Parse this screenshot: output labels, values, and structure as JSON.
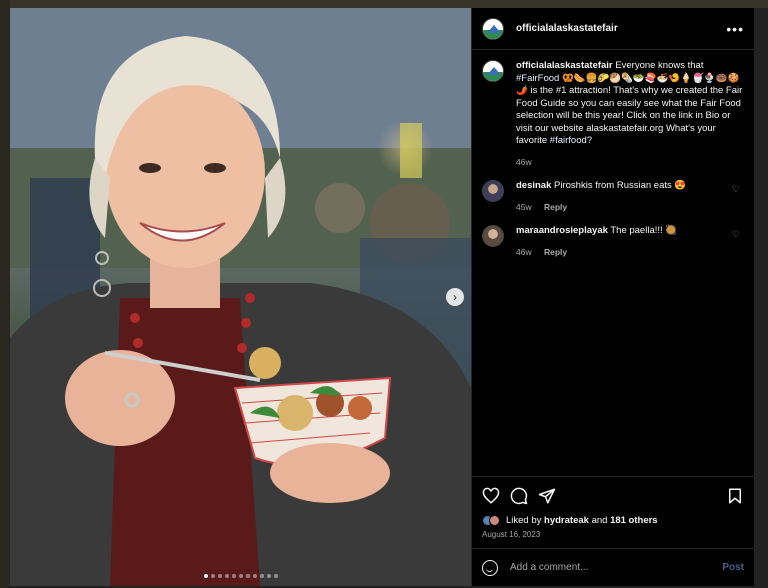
{
  "post": {
    "account": "officialalaskastatefair",
    "more_icon": "ellipsis-icon",
    "caption": {
      "username": "officialalaskastatefair",
      "text_before_tag": "Everyone knows that",
      "hashtag": "#FairFood",
      "emojis": "🥨🌭🍔🌮🥙🌯🥗🍣🍜🍤🍦🍧🍨🍩🍪🌶️",
      "text_after": "is the #1 attraction! That's why we created the Fair Food Guide so you can easily see what the Fair Food selection will be this year! Click on the link in Bio or visit our website alaskastatefair.org What's your favorite",
      "hashtag2": "#fairfood?",
      "age": "46w"
    },
    "comments": [
      {
        "username": "desinak",
        "text": "Piroshkis from Russian eats 😍",
        "age": "45w",
        "reply": "Reply"
      },
      {
        "username": "maraandrosieplayak",
        "text": "The paella!!! 🥘",
        "age": "46w",
        "reply": "Reply"
      }
    ],
    "likes": {
      "prefix": "Liked by",
      "user": "hydrateak",
      "and": "and",
      "others": "181 others"
    },
    "date": "August 16, 2023",
    "add_comment_placeholder": "Add a comment...",
    "post_label": "Post",
    "carousel": {
      "count": 11,
      "active": 0
    }
  },
  "colors": {
    "background": "#000000",
    "text": "#f5f5f5",
    "muted": "#a8a8a8",
    "post_button": "#4a5d8a"
  }
}
